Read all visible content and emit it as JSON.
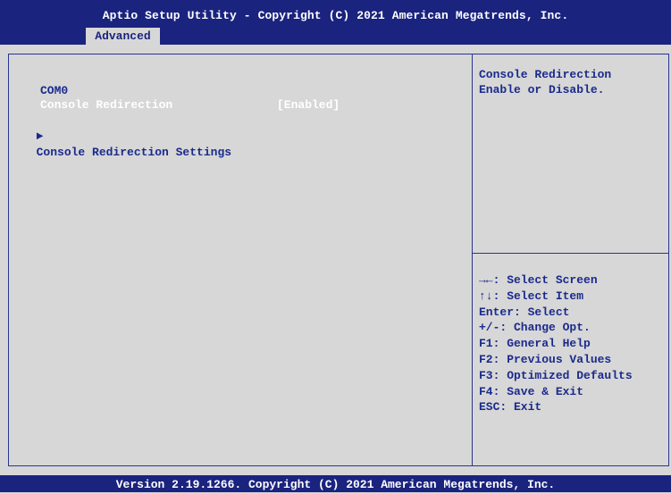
{
  "header": {
    "title": "Aptio Setup Utility - Copyright (C) 2021 American Megatrends, Inc.",
    "active_tab": "Advanced"
  },
  "menu": {
    "section_label": "COM0",
    "console_redirection": {
      "label": "Console Redirection",
      "value": "[Enabled]"
    },
    "settings_item": {
      "arrow": "►",
      "label": "Console Redirection Settings"
    }
  },
  "help": {
    "line1": "Console Redirection",
    "line2": "Enable or Disable."
  },
  "keys": [
    "→←: Select Screen",
    "↑↓: Select Item",
    "Enter: Select",
    "+/-: Change Opt.",
    "F1: General Help",
    "F2: Previous Values",
    "F3: Optimized Defaults",
    "F4: Save & Exit",
    "ESC: Exit"
  ],
  "footer": {
    "version": "Version 2.19.1266. Copyright (C) 2021 American Megatrends, Inc."
  }
}
